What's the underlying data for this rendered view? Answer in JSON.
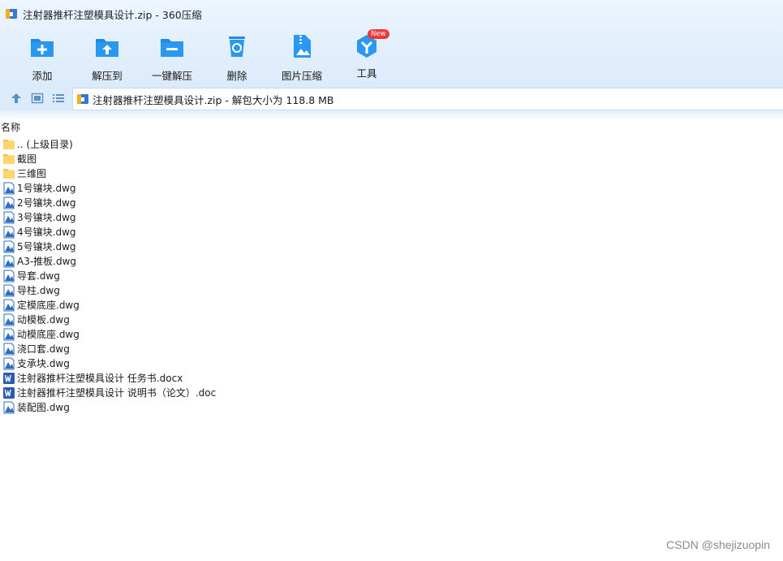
{
  "window": {
    "title": "注射器推杆注塑模具设计.zip - 360压缩"
  },
  "toolbar": {
    "items": [
      {
        "label": "添加",
        "icon": "add-icon"
      },
      {
        "label": "解压到",
        "icon": "extract-to-icon"
      },
      {
        "label": "一键解压",
        "icon": "one-click-extract-icon"
      },
      {
        "label": "删除",
        "icon": "delete-icon"
      },
      {
        "label": "图片压缩",
        "icon": "image-compress-icon"
      },
      {
        "label": "工具",
        "icon": "tools-icon",
        "badge": "New"
      }
    ]
  },
  "navbar": {
    "address_text": "注射器推杆注塑模具设计.zip - 解包大小为 118.8 MB"
  },
  "filelist": {
    "column_name": "名称",
    "rows": [
      {
        "name": ".. (上级目录)",
        "type": "folder"
      },
      {
        "name": "截图",
        "type": "folder"
      },
      {
        "name": "三维图",
        "type": "folder"
      },
      {
        "name": "1号镶块.dwg",
        "type": "dwg"
      },
      {
        "name": "2号镶块.dwg",
        "type": "dwg"
      },
      {
        "name": "3号镶块.dwg",
        "type": "dwg"
      },
      {
        "name": "4号镶块.dwg",
        "type": "dwg"
      },
      {
        "name": "5号镶块.dwg",
        "type": "dwg"
      },
      {
        "name": "A3-推板.dwg",
        "type": "dwg"
      },
      {
        "name": "导套.dwg",
        "type": "dwg"
      },
      {
        "name": "导柱.dwg",
        "type": "dwg"
      },
      {
        "name": "定模底座.dwg",
        "type": "dwg"
      },
      {
        "name": "动模板.dwg",
        "type": "dwg"
      },
      {
        "name": "动模底座.dwg",
        "type": "dwg"
      },
      {
        "name": "浇口套.dwg",
        "type": "dwg"
      },
      {
        "name": "支承块.dwg",
        "type": "dwg"
      },
      {
        "name": "注射器推杆注塑模具设计 任务书.docx",
        "type": "doc"
      },
      {
        "name": "注射器推杆注塑模具设计 说明书（论文）.doc",
        "type": "doc"
      },
      {
        "name": "装配图.dwg",
        "type": "dwg"
      }
    ]
  },
  "watermark": "CSDN @shejizuopin",
  "colors": {
    "accent": "#1e8be8",
    "toolbar_bg": "#e3effc",
    "folder": "#ffd66b",
    "word": "#2b5bb8",
    "new_badge": "#f0383a"
  }
}
